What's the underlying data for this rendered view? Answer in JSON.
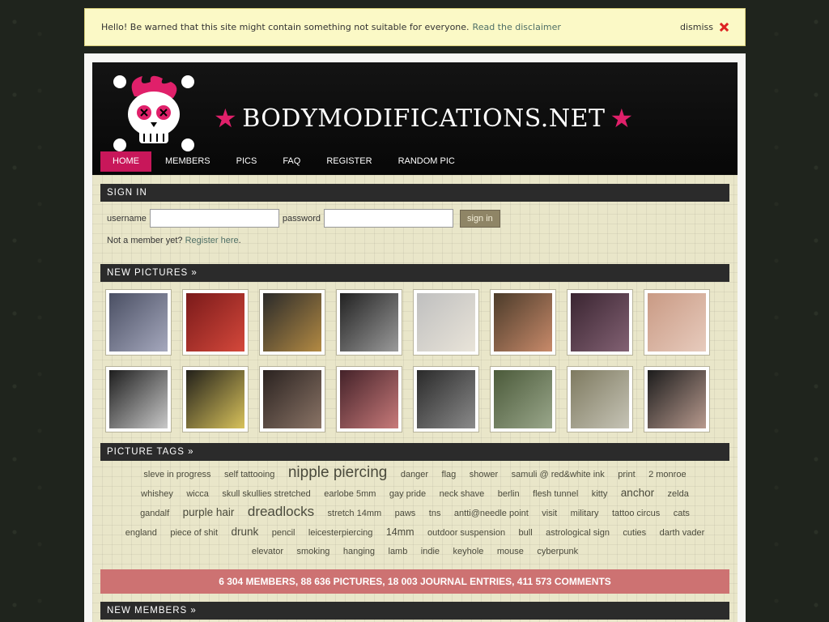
{
  "notice": {
    "text": "Hello! Be warned that this site might contain something not suitable for everyone.",
    "link": "Read the disclaimer",
    "dismiss": "dismiss"
  },
  "header": {
    "site_name": "BODYMODIFICATIONS.NET",
    "accent": "#c8175a",
    "nav": [
      {
        "label": "HOME",
        "active": true
      },
      {
        "label": "MEMBERS"
      },
      {
        "label": "PICS"
      },
      {
        "label": "FAQ"
      },
      {
        "label": "REGISTER"
      },
      {
        "label": "RANDOM PIC"
      }
    ]
  },
  "signin": {
    "title": "SIGN IN",
    "username_label": "username",
    "password_label": "password",
    "button": "sign in",
    "not_member": "Not a member yet?",
    "register_link": "Register here"
  },
  "new_pictures": {
    "title": "NEW PICTURES »",
    "thumbs": [
      {
        "colors": [
          "#4a4f63",
          "#a5a8bd"
        ]
      },
      {
        "colors": [
          "#7a1a1a",
          "#d4483b"
        ]
      },
      {
        "colors": [
          "#2a2a2a",
          "#b38a43"
        ]
      },
      {
        "colors": [
          "#222222",
          "#9a9a9a"
        ]
      },
      {
        "colors": [
          "#bfbfbf",
          "#e9e4d9"
        ]
      },
      {
        "colors": [
          "#4b3b2a",
          "#c88a6a"
        ]
      },
      {
        "colors": [
          "#3a2531",
          "#826173"
        ]
      },
      {
        "colors": [
          "#c99a84",
          "#e7cbbd"
        ]
      },
      {
        "colors": [
          "#1e1e1e",
          "#c9c9c9"
        ]
      },
      {
        "colors": [
          "#22201a",
          "#d8c25b"
        ]
      },
      {
        "colors": [
          "#2a2220",
          "#8a7466"
        ]
      },
      {
        "colors": [
          "#442229",
          "#c87a7a"
        ]
      },
      {
        "colors": [
          "#2a2a2a",
          "#8a8a8a"
        ]
      },
      {
        "colors": [
          "#4b5a3a",
          "#9aa78b"
        ]
      },
      {
        "colors": [
          "#7e7a60",
          "#c6c4b6"
        ]
      },
      {
        "colors": [
          "#1c1c1c",
          "#b89a8e"
        ]
      }
    ]
  },
  "picture_tags": {
    "title": "PICTURE TAGS »",
    "tags": [
      {
        "label": "sleve in progress",
        "size": 0
      },
      {
        "label": "self tattooing",
        "size": 0
      },
      {
        "label": "nipple piercing",
        "size": 4
      },
      {
        "label": "danger",
        "size": 0
      },
      {
        "label": "flag",
        "size": 0
      },
      {
        "label": "shower",
        "size": 0
      },
      {
        "label": "samuli @ red&white ink",
        "size": 0
      },
      {
        "label": "print",
        "size": 0
      },
      {
        "label": "2 monroe",
        "size": 0
      },
      {
        "label": "whishey",
        "size": 0
      },
      {
        "label": "wicca",
        "size": 0
      },
      {
        "label": "skull skullies stretched",
        "size": 0
      },
      {
        "label": "earlobe 5mm",
        "size": 0
      },
      {
        "label": "gay pride",
        "size": 0
      },
      {
        "label": "neck shave",
        "size": 0
      },
      {
        "label": "berlin",
        "size": 0
      },
      {
        "label": "flesh tunnel",
        "size": 0
      },
      {
        "label": "kitty",
        "size": 0
      },
      {
        "label": "anchor",
        "size": 2
      },
      {
        "label": "zelda",
        "size": 0
      },
      {
        "label": "gandalf",
        "size": 0
      },
      {
        "label": "purple hair",
        "size": 2
      },
      {
        "label": "dreadlocks",
        "size": 3
      },
      {
        "label": "stretch 14mm",
        "size": 0
      },
      {
        "label": "paws",
        "size": 0
      },
      {
        "label": "tns",
        "size": 0
      },
      {
        "label": "antti@needle point",
        "size": 0
      },
      {
        "label": "visit",
        "size": 0
      },
      {
        "label": "military",
        "size": 0
      },
      {
        "label": "tattoo circus",
        "size": 0
      },
      {
        "label": "cats",
        "size": 0
      },
      {
        "label": "england",
        "size": 0
      },
      {
        "label": "piece of shit",
        "size": 0
      },
      {
        "label": "drunk",
        "size": 2
      },
      {
        "label": "pencil",
        "size": 0
      },
      {
        "label": "leicesterpiercing",
        "size": 0
      },
      {
        "label": "14mm",
        "size": 1
      },
      {
        "label": "outdoor suspension",
        "size": 0
      },
      {
        "label": "bull",
        "size": 0
      },
      {
        "label": "astrological sign",
        "size": 0
      },
      {
        "label": "cuties",
        "size": 0
      },
      {
        "label": "darth vader",
        "size": 0
      },
      {
        "label": "elevator",
        "size": 0
      },
      {
        "label": "smoking",
        "size": 0
      },
      {
        "label": "hanging",
        "size": 0
      },
      {
        "label": "lamb",
        "size": 0
      },
      {
        "label": "indie",
        "size": 0
      },
      {
        "label": "keyhole",
        "size": 0
      },
      {
        "label": "mouse",
        "size": 0
      },
      {
        "label": "cyberpunk",
        "size": 0
      }
    ]
  },
  "stats": "6 304 MEMBERS, 88 636 PICTURES, 18 003 JOURNAL ENTRIES, 411 573 COMMENTS",
  "new_members": {
    "title": "NEW MEMBERS »"
  }
}
